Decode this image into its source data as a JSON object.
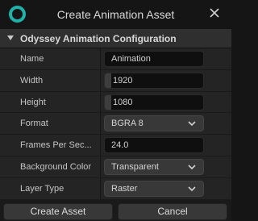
{
  "window": {
    "title": "Create Animation Asset"
  },
  "section": {
    "label": "Odyssey Animation Configuration"
  },
  "fields": {
    "name": {
      "label": "Name",
      "value": "Animation"
    },
    "width": {
      "label": "Width",
      "value": "1920"
    },
    "height": {
      "label": "Height",
      "value": "1080"
    },
    "format": {
      "label": "Format",
      "value": "BGRA 8"
    },
    "fps": {
      "label": "Frames Per Sec...",
      "value": "24.0"
    },
    "background": {
      "label": "Background Color",
      "value": "Transparent"
    },
    "layer_type": {
      "label": "Layer Type",
      "value": "Raster"
    }
  },
  "buttons": {
    "create": "Create Asset",
    "cancel": "Cancel"
  },
  "colors": {
    "accent": "#20b2aa"
  }
}
